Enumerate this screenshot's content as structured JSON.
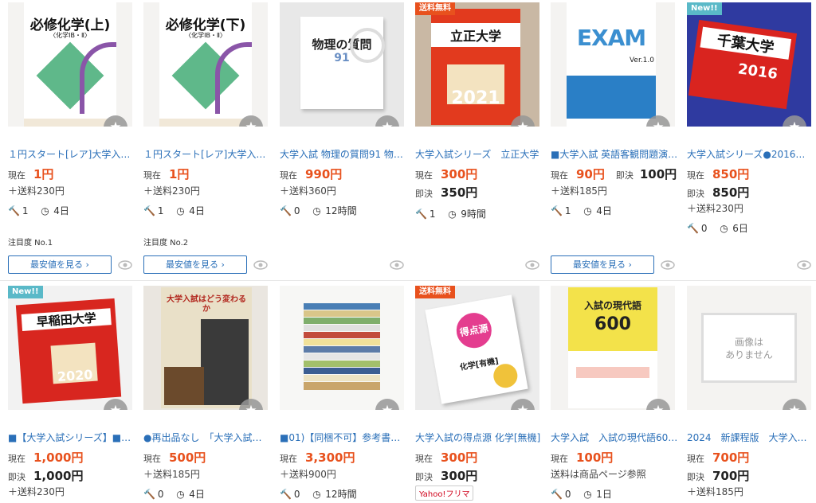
{
  "labels": {
    "current": "現在",
    "buynow": "即決",
    "cheapest": "最安値を見る ›",
    "badge_free": "送料無料",
    "badge_new": "New!!",
    "no_image": "画像は\nありません",
    "yahoo_flea": "Yahoo!フリマ"
  },
  "items": [
    {
      "title": "１円スタート[レア]大学入試…",
      "current": "1円",
      "shipping": "＋送料230円",
      "bids": "1",
      "time": "4日",
      "attention": "注目度 No.1",
      "book_title": "必修化学(上)",
      "book_sub": "〈化学ⅠB・Ⅱ〉"
    },
    {
      "title": "１円スタート[レア]大学入試…",
      "current": "1円",
      "shipping": "＋送料230円",
      "bids": "1",
      "time": "4日",
      "attention": "注目度 No.2",
      "book_title": "必修化学(下)",
      "book_sub": "〈化学ⅠB・Ⅱ〉"
    },
    {
      "title": "大学入試 物理の質問91 物理…",
      "current": "990円",
      "shipping": "＋送料360円",
      "bids": "0",
      "time": "12時間",
      "book_title": "物理の質問",
      "book_sub": "91"
    },
    {
      "title": "大学入試シリーズ　立正大学",
      "current": "300円",
      "buynow": "350円",
      "bids": "1",
      "time": "9時間",
      "book_title": "立正大学",
      "book_sub": "2021"
    },
    {
      "title": "■大学入試 英語客観問題演…",
      "current": "90円",
      "buynow": "100円",
      "shipping": "＋送料185円",
      "bids": "1",
      "time": "4日",
      "book_title": "EXAM",
      "book_sub": "Ver.1.0"
    },
    {
      "title": "大学入試シリーズ●2016千…",
      "current": "850円",
      "buynow": "850円",
      "shipping": "＋送料230円",
      "bids": "0",
      "time": "6日",
      "book_title": "千葉大学",
      "book_sub": "2016"
    },
    {
      "title": "■【大学入試シリーズ】■【…",
      "current": "1,000円",
      "buynow": "1,000円",
      "shipping": "＋送料230円",
      "book_title": "早稲田大学",
      "book_sub": "2020"
    },
    {
      "title": "●再出品なし　「大学入試は…",
      "current": "500円",
      "shipping": "＋送料185円",
      "bids": "0",
      "time": "4日",
      "book_title": "大学入試はどう変わるか"
    },
    {
      "title": "■01)【同梱不可】参考書・…",
      "current": "3,300円",
      "shipping": "＋送料900円",
      "bids": "0",
      "time": "12時間"
    },
    {
      "title": "大学入試の得点源 化学[無機]",
      "current": "300円",
      "buynow": "300円",
      "book_title": "得点源",
      "book_sub": "化学[有機]"
    },
    {
      "title": "大学入試　入試の現代語600…",
      "current": "100円",
      "shipping": "送料は商品ページ参照",
      "bids": "0",
      "time": "1日",
      "book_title": "入試の現代語",
      "book_sub": "600"
    },
    {
      "title": "2024　新課程版　大学入試…",
      "current": "700円",
      "buynow": "700円",
      "shipping": "＋送料185円"
    }
  ]
}
